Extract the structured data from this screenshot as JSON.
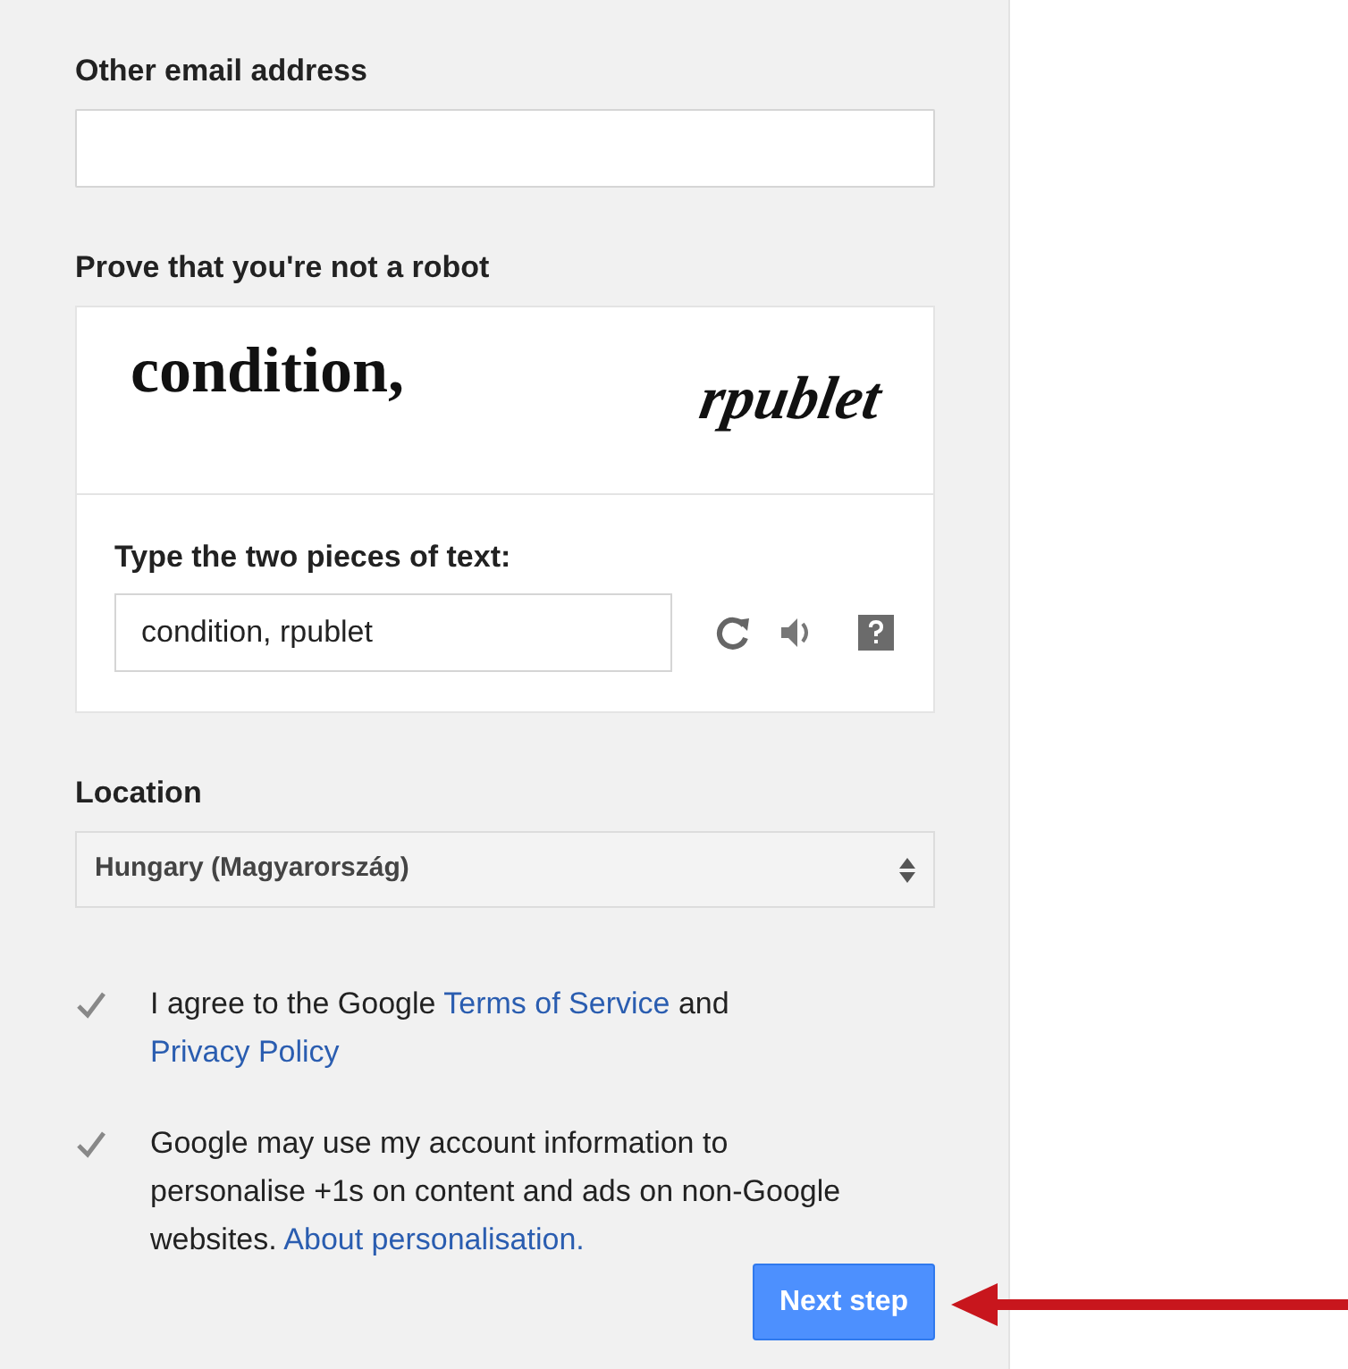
{
  "email": {
    "label": "Other email address"
  },
  "captcha": {
    "label": "Prove that you're not a robot",
    "words": [
      "condition,",
      "rpublet"
    ],
    "prompt": "Type the two pieces of text:",
    "value": "condition, rpublet"
  },
  "location": {
    "label": "Location",
    "value": "Hungary (Magyarország)"
  },
  "agreements": [
    {
      "checked": true,
      "parts": [
        {
          "text": "I agree to the Google ",
          "link": false
        },
        {
          "text": "Terms of Service",
          "link": true
        },
        {
          "text": " and ",
          "link": false
        },
        {
          "text": "Privacy Policy",
          "link": true
        }
      ]
    },
    {
      "checked": true,
      "parts": [
        {
          "text": "Google may use my account information to personalise +1s on content and ads on non-Google websites. ",
          "link": false
        },
        {
          "text": "About personalisation.",
          "link": true
        }
      ]
    }
  ],
  "next_button": "Next step"
}
